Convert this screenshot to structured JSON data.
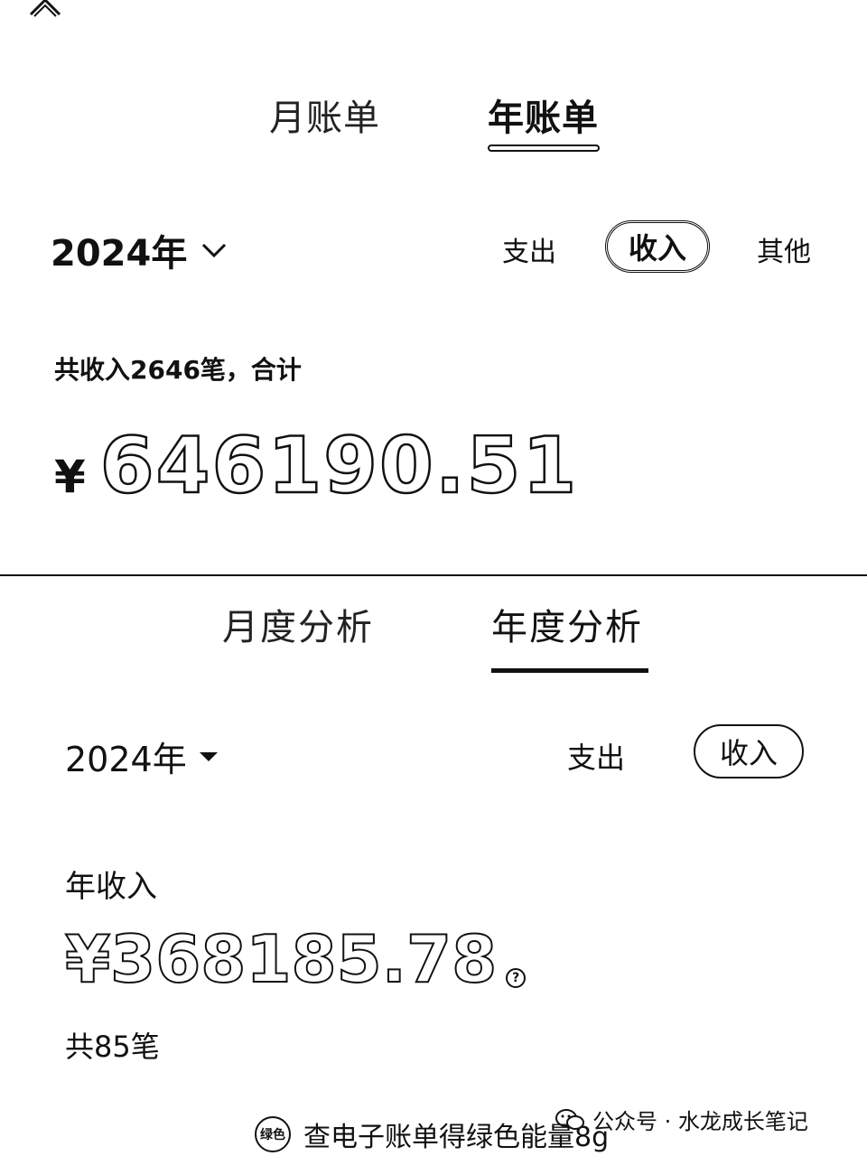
{
  "top": {
    "tabs": [
      {
        "label": "月账单",
        "active": false
      },
      {
        "label": "年账单",
        "active": true
      }
    ],
    "year_selector": "2024年",
    "filters": {
      "expense": "支出",
      "income": "收入",
      "other": "其他",
      "selected": "收入"
    },
    "summary_text": "共收入2646笔，合计",
    "currency_symbol": "¥",
    "amount": "646190.51"
  },
  "bottom": {
    "tabs": [
      {
        "label": "月度分析",
        "active": false
      },
      {
        "label": "年度分析",
        "active": true
      }
    ],
    "year_selector": "2024年",
    "filters": {
      "expense": "支出",
      "income": "收入",
      "selected": "收入"
    },
    "summary_label": "年收入",
    "amount": "¥368185.78",
    "help_symbol": "?",
    "count_text": "共85笔"
  },
  "footer": {
    "promo_icon_text": "绿色",
    "promo_text": "查电子账单得绿色能量8g",
    "watermark": "公众号 · 水龙成长笔记"
  },
  "icons": {
    "collapse": "chevron-up-icon",
    "year_dropdown_top": "chevron-down-icon",
    "year_dropdown_bottom": "caret-down-icon",
    "help": "help-icon",
    "promo": "green-energy-icon",
    "watermark": "wechat-icon"
  }
}
